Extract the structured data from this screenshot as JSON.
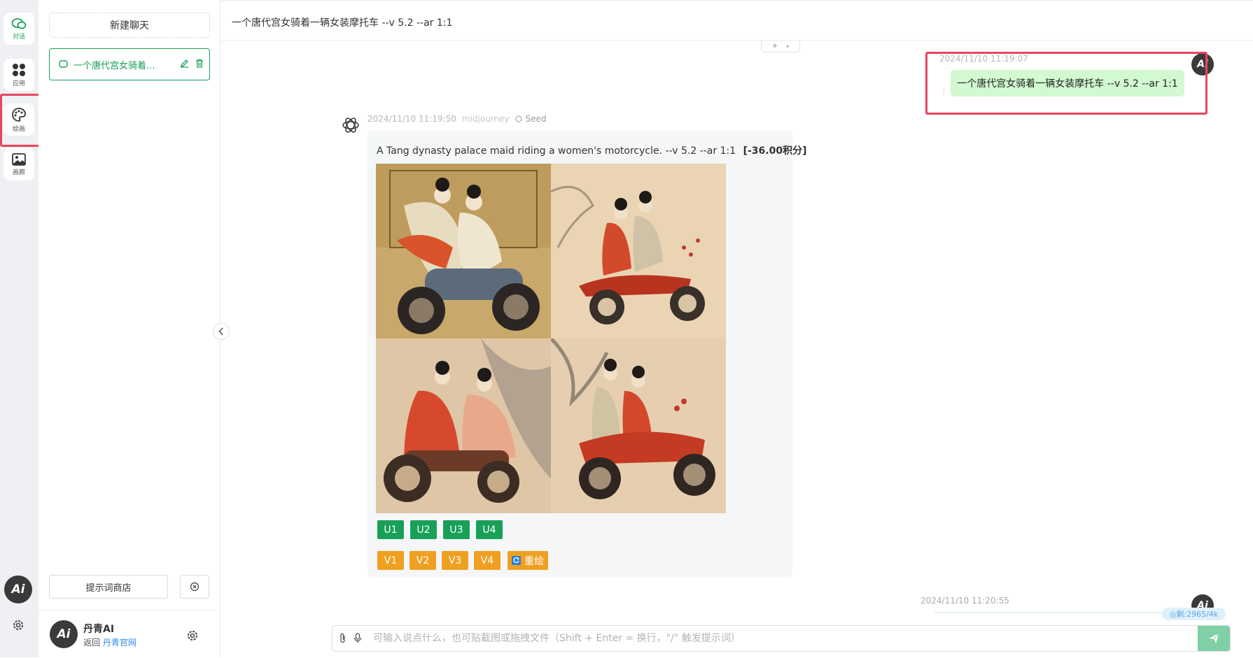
{
  "rail": {
    "items": [
      {
        "label": "对话",
        "icon": "chat-bubbles-icon"
      },
      {
        "label": "应用",
        "icon": "apps-grid-icon"
      },
      {
        "label": "绘画",
        "icon": "palette-icon"
      },
      {
        "label": "画廊",
        "icon": "image-gallery-icon"
      }
    ],
    "logo_text": "Ai"
  },
  "sidebar": {
    "new_chat_label": "新建聊天",
    "chat_item_title": "一个唐代宫女骑着...",
    "prompt_store_label": "提示词商店",
    "user": {
      "name": "丹青AI",
      "return_label": "返回",
      "site_link": "丹青官网"
    }
  },
  "header": {
    "title": "一个唐代宫女骑着一辆女装摩托车 --v 5.2 --ar 1:1"
  },
  "messages": {
    "user_msg": {
      "time": "2024/11/10 11:19:07",
      "text": "一个唐代宫女骑着一辆女装摩托车 --v 5.2 --ar 1:1"
    },
    "ai_msg": {
      "time": "2024/11/10 11:19:50",
      "model": "midjourney",
      "seed_label": "Seed",
      "prompt": "A Tang dynasty palace maid riding a women's motorcycle. --v 5.2 --ar 1:1",
      "cost": "[-36.00积分]",
      "u_buttons": [
        "U1",
        "U2",
        "U3",
        "U4"
      ],
      "v_buttons": [
        "V1",
        "V2",
        "V3",
        "V4"
      ],
      "redraw_label": "重绘"
    },
    "pending_time": "2024/11/10 11:20:55"
  },
  "input": {
    "placeholder": "可输入说点什么，也可贴截图或拖拽文件（Shift + Enter = 换行，\"/\" 触发提示词）",
    "value": ""
  },
  "counter_badge": "◎剩:2965/4k",
  "colors": {
    "accent": "#18a058",
    "variation": "#f0a020",
    "user_bubble": "#d2f9d1",
    "highlight": "#e8455e"
  }
}
